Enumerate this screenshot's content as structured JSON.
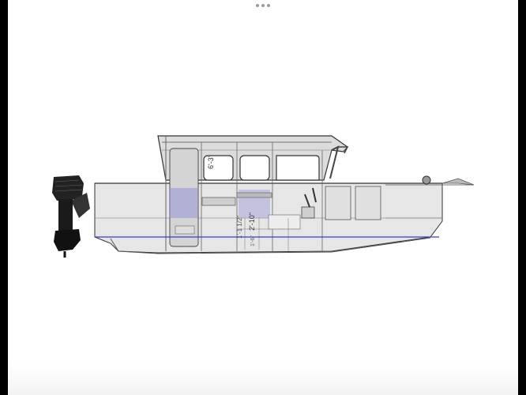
{
  "window": {
    "menu_icon": "more-horizontal-icon"
  },
  "drawing": {
    "dimensions": {
      "headroom": "6'-3\"",
      "bench_height": "2'-10\"",
      "side_vertical": "1'-1 1/2\"",
      "small_label": "1'-6\""
    },
    "colors": {
      "waterline": "#3a3ad0",
      "hull_fill": "#e6e6e6",
      "panel_fill": "#9a9ad6",
      "outline": "#333333"
    }
  }
}
